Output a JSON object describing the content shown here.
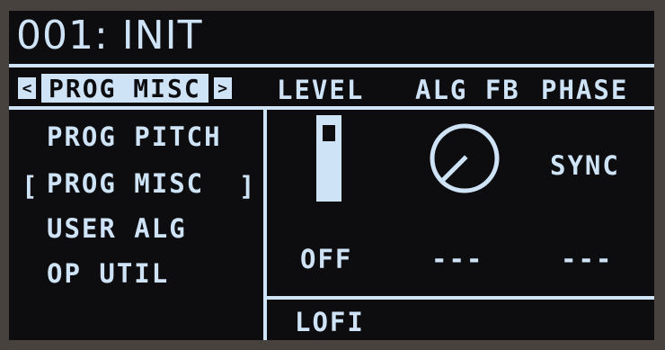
{
  "header": {
    "title": "001: INIT"
  },
  "tabbar": {
    "prev_arrow": "<",
    "selected_tab": "PROG MISC",
    "next_arrow": ">"
  },
  "columns": {
    "col1": "LEVEL",
    "col2": "ALG FB",
    "col3": "PHASE"
  },
  "menu": {
    "items": [
      "PROG PITCH",
      "PROG MISC",
      "USER ALG",
      "OP UTIL"
    ],
    "selected_index": 1,
    "bracket_open": "[",
    "bracket_close": "]"
  },
  "params": {
    "level": {
      "value": "OFF",
      "fill_fraction": 0.85
    },
    "alg_fb": {
      "value": "---"
    },
    "phase": {
      "label": "SYNC",
      "value": "---"
    }
  },
  "footer": {
    "label": "LOFI"
  },
  "colors": {
    "screen_bg": "#0d0d10",
    "foreground": "#cfe3f7",
    "bezel": "#47423d"
  }
}
